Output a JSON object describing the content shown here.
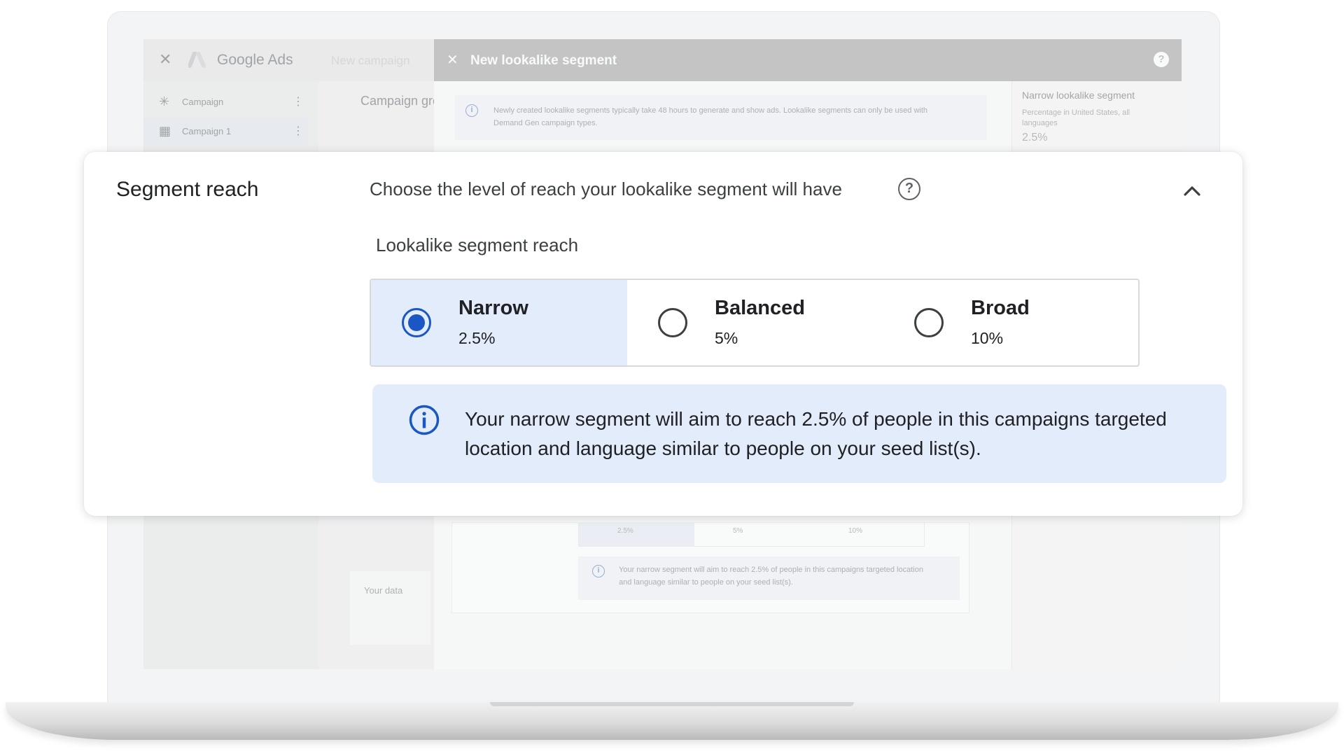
{
  "background_app": {
    "close_glyph": "✕",
    "app_name": "Google Ads",
    "breadcrumb": "New campaign",
    "dialog_close_glyph": "✕",
    "dialog_title": "New lookalike segment",
    "dialog_help_glyph": "?",
    "nav": [
      {
        "icon": "sparkle-icon",
        "glyph": "✳",
        "label": "Campaign",
        "menu": "⋮"
      },
      {
        "icon": "grid-icon",
        "glyph": "▦",
        "label": "Campaign 1",
        "menu": "⋮"
      }
    ],
    "campaign_group_title": "Campaign group",
    "your_data_label": "Your data",
    "info_notice": "Newly created lookalike segments typically take 48 hours to generate and show ads. Lookalike segments can only be used with Demand Gen campaign types.",
    "right_panel": {
      "title": "Narrow lookalike segment",
      "subtitle": "Percentage in United States, all languages",
      "value": "2.5%"
    },
    "mini_options": [
      "2.5%",
      "5%",
      "10%"
    ],
    "mini_info": "Your narrow segment will aim to reach 2.5% of people in this campaigns targeted location and language similar to people on your seed list(s)."
  },
  "card": {
    "title": "Segment reach",
    "description": "Choose the level of reach your lookalike segment will have",
    "help_glyph": "?",
    "reach_label": "Lookalike segment reach",
    "options": [
      {
        "name": "Narrow",
        "percent": "2.5%",
        "selected": true
      },
      {
        "name": "Balanced",
        "percent": "5%",
        "selected": false
      },
      {
        "name": "Broad",
        "percent": "10%",
        "selected": false
      }
    ],
    "info_text": "Your narrow segment will aim to reach 2.5% of people in this campaigns targeted location and language similar to people on your seed list(s)."
  },
  "colors": {
    "accent": "#1a56c4",
    "selected_bg": "#e3ecfb",
    "dialog_header": "#9e9e9e"
  },
  "icons": [
    "close-icon",
    "google-ads-logo-icon",
    "help-icon",
    "chevron-up-icon",
    "info-icon",
    "radio-selected-icon",
    "radio-unselected-icon"
  ]
}
